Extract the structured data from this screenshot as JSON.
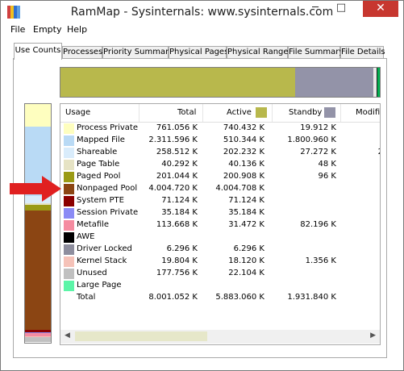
{
  "window": {
    "title": "RamMap - Sysinternals: www.sysinternals.com",
    "minimize": "─",
    "maximize": "□",
    "close": "✕"
  },
  "menu": [
    "File",
    "Empty",
    "Help"
  ],
  "tabs": [
    "Use Counts",
    "Processes",
    "Priority Summary",
    "Physical Pages",
    "Physical Ranges",
    "File Summary",
    "File Details"
  ],
  "active_tab": "Use Counts",
  "columns": {
    "usage": "Usage",
    "total": "Total",
    "active": "Active",
    "standby": "Standby",
    "modified": "Modifie"
  },
  "header_colors": {
    "active": "#b8b84c",
    "standby": "#9393a8"
  },
  "rows": [
    {
      "label": "Process Private",
      "color": "#fefebf",
      "total": "761.056 K",
      "active": "740.432 K",
      "standby": "19.912 K",
      "modified": ""
    },
    {
      "label": "Mapped File",
      "color": "#b9daf5",
      "total": "2.311.596 K",
      "active": "510.344 K",
      "standby": "1.800.960 K",
      "modified": ""
    },
    {
      "label": "Shareable",
      "color": "#d9ecfb",
      "total": "258.512 K",
      "active": "202.232 K",
      "standby": "27.272 K",
      "modified": "2"
    },
    {
      "label": "Page Table",
      "color": "#e6e3c4",
      "total": "40.292 K",
      "active": "40.136 K",
      "standby": "48 K",
      "modified": ""
    },
    {
      "label": "Paged Pool",
      "color": "#9a9a15",
      "total": "201.044 K",
      "active": "200.908 K",
      "standby": "96 K",
      "modified": ""
    },
    {
      "label": "Nonpaged Pool",
      "color": "#8b4513",
      "total": "4.004.720 K",
      "active": "4.004.708 K",
      "standby": "",
      "modified": ""
    },
    {
      "label": "System PTE",
      "color": "#8b0000",
      "total": "71.124 K",
      "active": "71.124 K",
      "standby": "",
      "modified": ""
    },
    {
      "label": "Session Private",
      "color": "#8b8bf5",
      "total": "35.184 K",
      "active": "35.184 K",
      "standby": "",
      "modified": ""
    },
    {
      "label": "Metafile",
      "color": "#f58ba0",
      "total": "113.668 K",
      "active": "31.472 K",
      "standby": "82.196 K",
      "modified": ""
    },
    {
      "label": "AWE",
      "color": "#000000",
      "total": "",
      "active": "",
      "standby": "",
      "modified": ""
    },
    {
      "label": "Driver Locked",
      "color": "#8e8e9e",
      "total": "6.296 K",
      "active": "6.296 K",
      "standby": "",
      "modified": ""
    },
    {
      "label": "Kernel Stack",
      "color": "#f5c2b8",
      "total": "19.804 K",
      "active": "18.120 K",
      "standby": "1.356 K",
      "modified": ""
    },
    {
      "label": "Unused",
      "color": "#c0c0c0",
      "total": "177.756 K",
      "active": "22.104 K",
      "standby": "",
      "modified": ""
    },
    {
      "label": "Large Page",
      "color": "#5cf5a8",
      "total": "",
      "active": "",
      "standby": "",
      "modified": ""
    },
    {
      "label": "Total",
      "color": "",
      "total": "8.001.052 K",
      "active": "5.883.060 K",
      "standby": "1.931.840 K",
      "modified": ""
    }
  ],
  "usage_bar": [
    {
      "color": "#b8b84c",
      "fraction": 0.735
    },
    {
      "color": "#9393a8",
      "fraction": 0.245
    },
    {
      "color": "#e9e9e9",
      "fraction": 0.01
    },
    {
      "color": "#1a1a1a",
      "fraction": 0.003
    },
    {
      "color": "#00b050",
      "fraction": 0.007
    }
  ],
  "left_bar": [
    {
      "color": "#fefebf",
      "fraction": 0.095
    },
    {
      "color": "#b9daf5",
      "fraction": 0.289
    },
    {
      "color": "#d9ecfb",
      "fraction": 0.032
    },
    {
      "color": "#e6e3c4",
      "fraction": 0.005
    },
    {
      "color": "#9a9a15",
      "fraction": 0.025
    },
    {
      "color": "#8b4513",
      "fraction": 0.5
    },
    {
      "color": "#8b0000",
      "fraction": 0.009
    },
    {
      "color": "#8b8bf5",
      "fraction": 0.004
    },
    {
      "color": "#f58ba0",
      "fraction": 0.014
    },
    {
      "color": "#8e8e9e",
      "fraction": 0.001
    },
    {
      "color": "#f5c2b8",
      "fraction": 0.002
    },
    {
      "color": "#c0c0c0",
      "fraction": 0.022
    }
  ]
}
